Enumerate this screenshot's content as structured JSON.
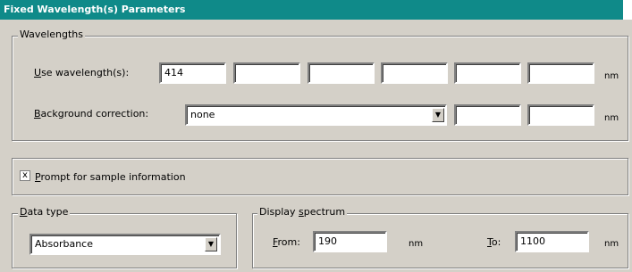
{
  "window": {
    "title": "Fixed Wavelength(s) Parameters"
  },
  "wavelengths": {
    "group_label": "Wavelengths",
    "use_label_u": "U",
    "use_label_rest": "se wavelength(s):",
    "values": [
      "414",
      "",
      "",
      "",
      "",
      ""
    ],
    "unit": "nm",
    "background_label_u": "B",
    "background_label_rest": "ackground correction:",
    "background_value": "none",
    "background_extra": [
      "",
      ""
    ],
    "background_unit": "nm"
  },
  "prompt": {
    "checked_mark": "x",
    "label_u": "P",
    "label_rest": "rompt for sample information"
  },
  "data_type": {
    "group_label_u": "D",
    "group_label_rest": "ata type",
    "value": "Absorbance"
  },
  "display_spectrum": {
    "group_label_pre": "Display ",
    "group_label_u": "s",
    "group_label_post": "pectrum",
    "from_label_u": "F",
    "from_label_rest": "rom:",
    "from_value": "190",
    "from_unit": "nm",
    "to_label_u": "T",
    "to_label_rest": "o:",
    "to_value": "1100",
    "to_unit": "nm"
  }
}
